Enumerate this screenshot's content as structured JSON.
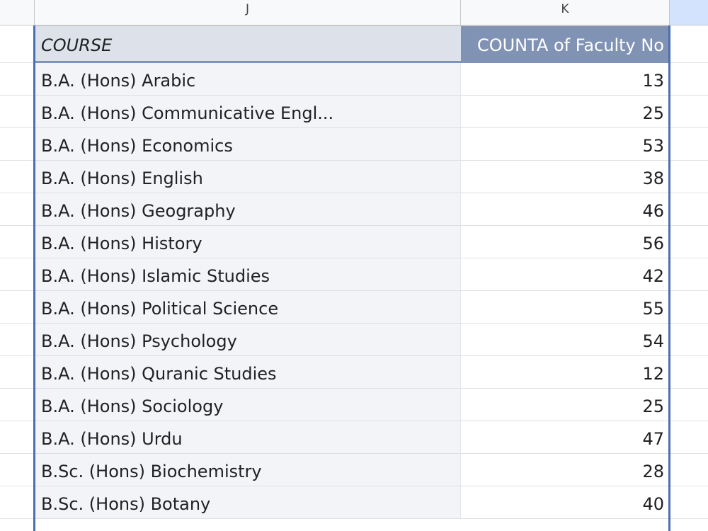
{
  "columns": {
    "J": "J",
    "K": "K"
  },
  "pivot": {
    "header_course": "COURSE",
    "header_count": "COUNTA of Faculty No",
    "rows": [
      {
        "course": "B.A. (Hons) Arabic",
        "count": "13"
      },
      {
        "course": "B.A. (Hons) Communicative Engl...",
        "count": "25"
      },
      {
        "course": "B.A. (Hons) Economics",
        "count": "53"
      },
      {
        "course": "B.A. (Hons) English",
        "count": "38"
      },
      {
        "course": "B.A. (Hons) Geography",
        "count": "46"
      },
      {
        "course": "B.A. (Hons) History",
        "count": "56"
      },
      {
        "course": "B.A. (Hons) Islamic Studies",
        "count": "42"
      },
      {
        "course": "B.A. (Hons) Political Science",
        "count": "55"
      },
      {
        "course": "B.A. (Hons) Psychology",
        "count": "54"
      },
      {
        "course": "B.A. (Hons) Quranic Studies",
        "count": "12"
      },
      {
        "course": "B.A. (Hons) Sociology",
        "count": "25"
      },
      {
        "course": "B.A. (Hons) Urdu",
        "count": "47"
      },
      {
        "course": "B.Sc. (Hons) Biochemistry",
        "count": "28"
      },
      {
        "course": "B.Sc. (Hons) Botany",
        "count": "40"
      }
    ]
  }
}
